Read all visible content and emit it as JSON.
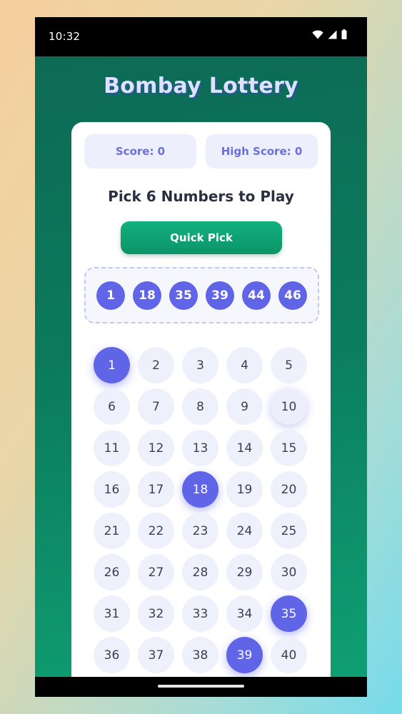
{
  "status": {
    "time": "10:32",
    "icons": [
      "wifi-icon",
      "cell-signal-icon",
      "battery-icon"
    ]
  },
  "app": {
    "title": "Bombay Lottery"
  },
  "scores": {
    "score_label": "Score: 0",
    "high_score_label": "High Score: 0"
  },
  "prompt": "Pick 6 Numbers to Play",
  "quick_pick_label": "Quick Pick",
  "picked": [
    "1",
    "18",
    "35",
    "39",
    "44",
    "46"
  ],
  "grid": {
    "numbers": [
      "1",
      "2",
      "3",
      "4",
      "5",
      "6",
      "7",
      "8",
      "9",
      "10",
      "11",
      "12",
      "13",
      "14",
      "15",
      "16",
      "17",
      "18",
      "19",
      "20",
      "21",
      "22",
      "23",
      "24",
      "25",
      "26",
      "27",
      "28",
      "29",
      "30",
      "31",
      "32",
      "33",
      "34",
      "35",
      "36",
      "37",
      "38",
      "39",
      "40"
    ],
    "selected": [
      "1",
      "18",
      "35",
      "39"
    ],
    "hovered": "10"
  },
  "colors": {
    "accent": "#6064e6",
    "primary_button": "#0f9f72",
    "background_green": "#0b7a5c"
  }
}
